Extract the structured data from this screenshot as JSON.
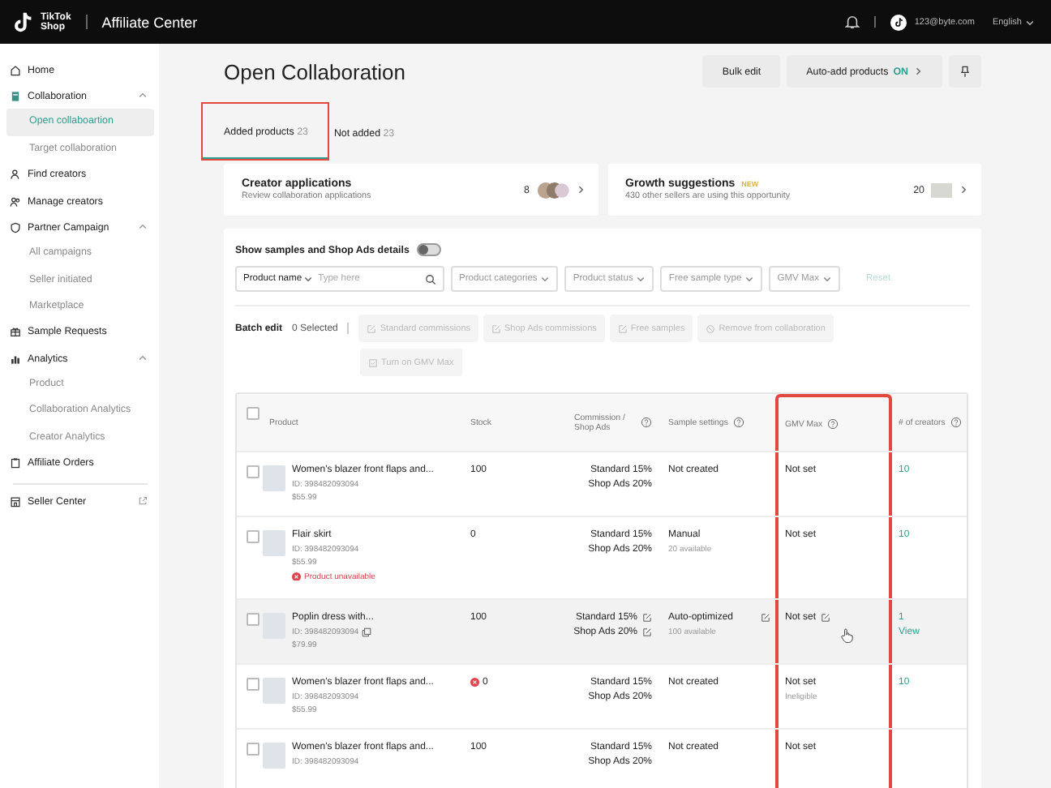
{
  "header": {
    "logo_top": "TikTok",
    "logo_bottom": "Shop",
    "title": "Affiliate Center",
    "account": "123@byte.com",
    "language": "English"
  },
  "sidebar": {
    "items": [
      {
        "label": "Home",
        "selected": false
      },
      {
        "label": "Collaboration",
        "selected": false,
        "children": [
          {
            "label": "Open collaboartion",
            "selected": true
          },
          {
            "label": "Target collaboration",
            "selected": false
          }
        ]
      },
      {
        "label": "Find creators",
        "selected": false
      },
      {
        "label": "Manage creators",
        "selected": false
      },
      {
        "label": "Partner Campaign",
        "selected": false,
        "children": [
          {
            "label": "All campaigns",
            "selected": false
          },
          {
            "label": "Seller initiated",
            "selected": false
          },
          {
            "label": "Marketplace",
            "selected": false
          }
        ]
      },
      {
        "label": "Sample Requests",
        "selected": false
      },
      {
        "label": "Analytics",
        "selected": false,
        "children": [
          {
            "label": "Product",
            "selected": false
          },
          {
            "label": "Collaboration Analytics",
            "selected": false
          },
          {
            "label": "Creator Analytics",
            "selected": false
          }
        ]
      },
      {
        "label": "Affiliate Orders",
        "selected": false
      }
    ],
    "footer": {
      "label": "Seller Center"
    }
  },
  "page": {
    "title": "Open Collaboration",
    "bulk_edit": "Bulk edit",
    "auto_add": {
      "label": "Auto-add products",
      "status": "ON"
    }
  },
  "tabs": [
    {
      "label": "Added products",
      "count": "23",
      "selected": true,
      "highlighted": true
    },
    {
      "label": "Not added",
      "count": "23",
      "selected": false,
      "highlighted": false
    }
  ],
  "cards": [
    {
      "title": "Creator applications",
      "subtitle": "Review collaboration applications",
      "count": "8",
      "kind": "avatars"
    },
    {
      "title": "Growth suggestions",
      "badge": "NEW",
      "subtitle": "430 other sellers are using this opportunity",
      "count": "20",
      "kind": "thumbnail"
    }
  ],
  "toggle": {
    "label": "Show samples and Shop Ads details",
    "on": false
  },
  "filters": {
    "field_select": "Product name",
    "placeholder": "Type here",
    "dropdowns": [
      "Product categories",
      "Product status",
      "Free sample type",
      "GMV Max"
    ],
    "reset": {
      "label": "Reset",
      "disabled": true
    }
  },
  "batch": {
    "label": "Batch edit",
    "selected": "0 Selected",
    "actions": [
      {
        "label": "Standard commissions",
        "kind": "edit",
        "disabled": true
      },
      {
        "label": "Shop Ads commissions",
        "kind": "edit",
        "disabled": true
      },
      {
        "label": "Free samples",
        "kind": "edit",
        "disabled": true
      },
      {
        "label": "Remove from collaboration",
        "kind": "remove",
        "disabled": true
      },
      {
        "label": "Turn on GMV Max",
        "kind": "toggle",
        "disabled": true
      }
    ]
  },
  "table": {
    "select_all_checked": false,
    "columns": [
      {
        "label": "Product",
        "help": false,
        "highlighted": false
      },
      {
        "label": "Stock",
        "help": false,
        "highlighted": false
      },
      {
        "label": "Commission / Shop Ads",
        "help": true,
        "highlighted": false
      },
      {
        "label": "Sample settings",
        "help": true,
        "highlighted": false
      },
      {
        "label": "GMV Max",
        "help": true,
        "highlighted": true
      },
      {
        "label": "# of creators",
        "help": true,
        "highlighted": false
      }
    ],
    "rows": [
      {
        "checked": false,
        "hovered": false,
        "name": "Women's blazer front flaps and...",
        "id": "ID: 398482093094",
        "price": "$55.99",
        "stock": "100",
        "stock_error": false,
        "commission": [
          "Standard 15%",
          "Shop Ads 20%"
        ],
        "sample": "Not created",
        "gmv": "Not set",
        "creators": "10"
      },
      {
        "checked": false,
        "hovered": false,
        "name": "Flair skirt",
        "id": "ID: 398482093094",
        "price": "$55.99",
        "warning": "Product unavailable",
        "stock": "0",
        "stock_error": false,
        "commission": [
          "Standard 15%",
          "Shop Ads 20%"
        ],
        "sample": "Manual",
        "sample_note": "20 available",
        "gmv": "Not set",
        "creators": "10"
      },
      {
        "checked": false,
        "hovered": true,
        "name": "Poplin dress with...",
        "id": "ID: 398482093094",
        "price": "$79.99",
        "stock": "100",
        "stock_error": false,
        "commission": [
          "Standard 15%",
          "Shop Ads 20%"
        ],
        "sample": "Auto-optimized",
        "sample_note": "100 available",
        "gmv": "Not set",
        "creators": "1",
        "creators_link": "View"
      },
      {
        "checked": false,
        "hovered": false,
        "name": "Women's blazer front flaps and...",
        "id": "ID: 398482093094",
        "price": "$55.99",
        "stock": "0",
        "stock_error": true,
        "commission": [
          "Standard 15%",
          "Shop Ads 20%"
        ],
        "sample": "Not created",
        "gmv": "Not set",
        "gmv_note": "Ineligible",
        "creators": "10"
      },
      {
        "checked": false,
        "hovered": false,
        "name": "Women's blazer front flaps and...",
        "id": "ID: 398482093094",
        "stock": "100",
        "stock_error": false,
        "commission": [
          "Standard 15%",
          "Shop Ads 20%"
        ],
        "sample": "Not created",
        "gmv": "Not set"
      }
    ]
  }
}
